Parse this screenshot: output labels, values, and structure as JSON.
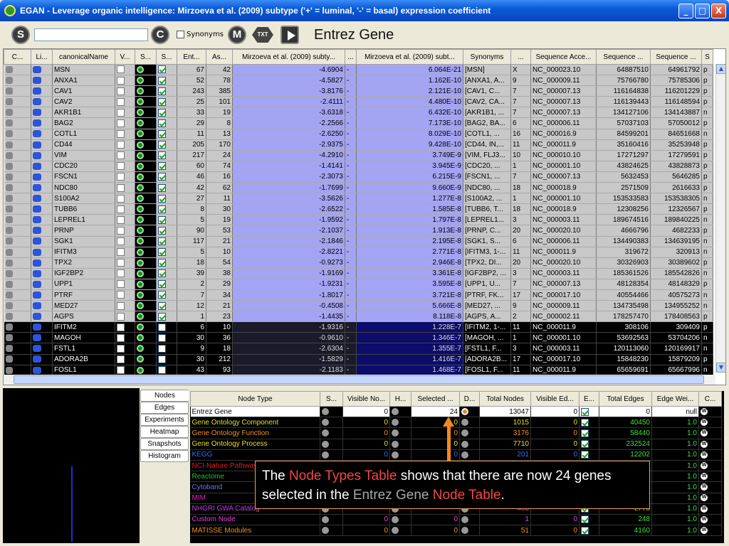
{
  "window": {
    "title": "EGAN - Leverage organic intelligence: Mirzoeva et al. (2009) subtype ('+' = luminal, '-' = basal) expression coefficient",
    "min": "_",
    "max": "□",
    "close": "X"
  },
  "toolbar": {
    "s_label": "S",
    "c_label": "C",
    "m_label": "M",
    "txt_label": "TXT",
    "synonyms_label": "Synonyms",
    "search_value": "",
    "title": "Entrez Gene"
  },
  "columns": [
    "C...",
    "Li...",
    "canonicalName",
    "V...",
    "S...",
    "S...",
    "Ent...",
    "As...",
    "Mirzoeva et al. (2009) subty...",
    "...",
    "Mirzoeva et al. (2009) subt...",
    "Synonyms",
    "...",
    "Sequence Acce...",
    "Sequence ...",
    "Sequence ...",
    "S"
  ],
  "rows": [
    [
      "MSN",
      "67",
      "42",
      "-4.6904",
      "-",
      "6.064E-21",
      "[MSN]",
      "X",
      "NC_000023.10",
      "64887510",
      "64961792",
      "p"
    ],
    [
      "ANXA1",
      "52",
      "78",
      "-4.5827",
      "-",
      "1.162E-10",
      "[ANXA1, A...",
      "9",
      "NC_000009.11",
      "75766780",
      "75785306",
      "p"
    ],
    [
      "CAV1",
      "243",
      "385",
      "-3.8176",
      "-",
      "2.121E-10",
      "[CAV1, C...",
      "7",
      "NC_000007.13",
      "116164838",
      "116201229",
      "p"
    ],
    [
      "CAV2",
      "25",
      "101",
      "-2.4111",
      "-",
      "4.480E-10",
      "[CAV2, CA...",
      "7",
      "NC_000007.13",
      "116139443",
      "116148594",
      "p"
    ],
    [
      "AKR1B1",
      "33",
      "19",
      "-3.6318",
      "-",
      "6.432E-10",
      "[AKR1B1, ...",
      "7",
      "NC_000007.13",
      "134127106",
      "134143887",
      "n"
    ],
    [
      "BAG2",
      "29",
      "8",
      "-2.2566",
      "-",
      "7.173E-10",
      "[BAG2, BA...",
      "6",
      "NC_000006.11",
      "57037103",
      "57050012",
      "p"
    ],
    [
      "COTL1",
      "11",
      "13",
      "-2.6250",
      "-",
      "8.029E-10",
      "[COTL1, ...",
      "16",
      "NC_000016.9",
      "84599201",
      "84651668",
      "n"
    ],
    [
      "CD44",
      "205",
      "170",
      "-2.9375",
      "-",
      "9.428E-10",
      "[CD44, IN,...",
      "11",
      "NC_000011.9",
      "35160416",
      "35253948",
      "p"
    ],
    [
      "VIM",
      "217",
      "24",
      "-4.2910",
      "-",
      "3.749E-9",
      "[VIM, FLJ3...",
      "10",
      "NC_000010.10",
      "17271297",
      "17279591",
      "p"
    ],
    [
      "CDC20",
      "60",
      "74",
      "-1.4141",
      "-",
      "3.945E-9",
      "[CDC20, ...",
      "1",
      "NC_000001.10",
      "43824625",
      "43828873",
      "p"
    ],
    [
      "FSCN1",
      "46",
      "16",
      "-2.3073",
      "-",
      "6.215E-9",
      "[FSCN1, ...",
      "7",
      "NC_000007.13",
      "5632453",
      "5646285",
      "p"
    ],
    [
      "NDC80",
      "42",
      "62",
      "-1.7699",
      "-",
      "9.660E-9",
      "[NDC80, ...",
      "18",
      "NC_000018.9",
      "2571509",
      "2616633",
      "p"
    ],
    [
      "S100A2",
      "27",
      "11",
      "-3.5626",
      "-",
      "1.277E-8",
      "[S100A2, ...",
      "1",
      "NC_000001.10",
      "153533583",
      "153538305",
      "n"
    ],
    [
      "TUBB6",
      "8",
      "30",
      "-2.6522",
      "-",
      "1.585E-8",
      "[TUBB6, T...",
      "18",
      "NC_000018.9",
      "12308256",
      "12326567",
      "p"
    ],
    [
      "LEPREL1",
      "5",
      "19",
      "-1.9592",
      "-",
      "1.797E-8",
      "[LEPREL1...",
      "3",
      "NC_000003.11",
      "189674516",
      "189840225",
      "n"
    ],
    [
      "PRNP",
      "90",
      "53",
      "-2.1037",
      "-",
      "1.913E-8",
      "[PRNP, C...",
      "20",
      "NC_000020.10",
      "4666796",
      "4682233",
      "p"
    ],
    [
      "SGK1",
      "117",
      "21",
      "-2.1846",
      "-",
      "2.195E-8",
      "[SGK1, S...",
      "6",
      "NC_000006.11",
      "134490383",
      "134639195",
      "n"
    ],
    [
      "IFITM3",
      "5",
      "10",
      "-2.8221",
      "-",
      "2.771E-8",
      "[IFITM3, 1-...",
      "11",
      "NC_000011.9",
      "319672",
      "320913",
      "n"
    ],
    [
      "TPX2",
      "18",
      "54",
      "-0.9273",
      "-",
      "2.946E-8",
      "[TPX2, DI...",
      "20",
      "NC_000020.10",
      "30326903",
      "30389602",
      "p"
    ],
    [
      "IGF2BP2",
      "39",
      "38",
      "-1.9169",
      "-",
      "3.361E-8",
      "[IGF2BP2, ...",
      "3",
      "NC_000003.11",
      "185361526",
      "185542826",
      "n"
    ],
    [
      "UPP1",
      "2",
      "29",
      "-1.9231",
      "-",
      "3.595E-8",
      "[UPP1, U...",
      "7",
      "NC_000007.13",
      "48128354",
      "48148329",
      "p"
    ],
    [
      "PTRF",
      "7",
      "34",
      "-1.8017",
      "-",
      "3.721E-8",
      "[PTRF, FK...",
      "17",
      "NC_000017.10",
      "40554466",
      "40575273",
      "n"
    ],
    [
      "MED27",
      "12",
      "21",
      "-0.4508",
      "-",
      "5.666E-8",
      "[MED27, ...",
      "9",
      "NC_000009.11",
      "134735498",
      "134955252",
      "n"
    ],
    [
      "AGPS",
      "1",
      "23",
      "-1.4435",
      "-",
      "8.118E-8",
      "[AGPS, A...",
      "2",
      "NC_000002.11",
      "178257470",
      "178408563",
      "p"
    ],
    [
      "IFITM2",
      "6",
      "10",
      "-1.9316",
      "-",
      "1.228E-7",
      "[IFITM2, 1-...",
      "11",
      "NC_000011.9",
      "308106",
      "309409",
      "p"
    ],
    [
      "MAGOH",
      "30",
      "36",
      "-0.9610",
      "-",
      "1.346E-7",
      "[MAGOH, ...",
      "1",
      "NC_000001.10",
      "53692563",
      "53704206",
      "n"
    ],
    [
      "FSTL1",
      "9",
      "18",
      "-2.6304",
      "-",
      "1.355E-7",
      "[FSTL1, F...",
      "3",
      "NC_000003.11",
      "120113060",
      "120169917",
      "n"
    ],
    [
      "ADORA2B",
      "30",
      "212",
      "-1.5829",
      "-",
      "1.416E-7",
      "[ADORA2B...",
      "17",
      "NC_000017.10",
      "15848230",
      "15879209",
      "p"
    ],
    [
      "FOSL1",
      "43",
      "93",
      "-2.1183",
      "-",
      "1.468E-7",
      "[FOSL1, F...",
      "11",
      "NC_000011.9",
      "65659691",
      "65667996",
      "n"
    ]
  ],
  "selected_row_count": 24,
  "side_tabs": [
    "Nodes",
    "Edges",
    "Experiments",
    "Heatmap",
    "Snapshots",
    "Histogram"
  ],
  "node_columns": [
    "Node Type",
    "S...",
    "Visible No...",
    "H...",
    "Selected ...",
    "D...",
    "Total Nodes",
    "Visible Ed...",
    "E...",
    "Total Edges",
    "Edge Wei...",
    "C..."
  ],
  "node_rows": [
    {
      "name": "Entrez Gene",
      "color": "#000000",
      "visible": "0",
      "selected": "24",
      "total": "13047",
      "vis_edges": "0",
      "total_edges": "0",
      "weight": "null"
    },
    {
      "name": "Gene Ontology Component",
      "color": "#e0e020",
      "visible": "0",
      "selected": "0",
      "total": "1015",
      "vis_edges": "0",
      "total_edges": "40450",
      "weight": "1.0"
    },
    {
      "name": "Gene Ontology Function",
      "color": "#f09020",
      "visible": "0",
      "selected": "0",
      "total": "3176",
      "vis_edges": "0",
      "total_edges": "58440",
      "weight": "1.0"
    },
    {
      "name": "Gene Ontology Process",
      "color": "#e8e020",
      "visible": "0",
      "selected": "0",
      "total": "7710",
      "vis_edges": "0",
      "total_edges": "232524",
      "weight": "1.0"
    },
    {
      "name": "KEGG",
      "color": "#3070f0",
      "visible": "0",
      "selected": "0",
      "total": "201",
      "vis_edges": "0",
      "total_edges": "12202",
      "weight": "1.0"
    },
    {
      "name": "NCI-Nature Pathway",
      "color": "#e02020",
      "visible": "",
      "selected": "",
      "total": "",
      "vis_edges": "",
      "total_edges": "",
      "weight": "1.0"
    },
    {
      "name": "Reactome",
      "color": "#20c020",
      "visible": "",
      "selected": "",
      "total": "",
      "vis_edges": "",
      "total_edges": "",
      "weight": "1.0"
    },
    {
      "name": "Cytoband",
      "color": "#7070f0",
      "visible": "",
      "selected": "",
      "total": "",
      "vis_edges": "",
      "total_edges": "",
      "weight": "1.0"
    },
    {
      "name": "MIM",
      "color": "#e020c0",
      "visible": "",
      "selected": "",
      "total": "",
      "vis_edges": "",
      "total_edges": "",
      "weight": "1.0"
    },
    {
      "name": "NHGRI GWA Catalog",
      "color": "#c040e0",
      "visible": "",
      "selected": "",
      "total": "403",
      "vis_edges": "",
      "total_edges": "2773",
      "weight": "1.0"
    },
    {
      "name": "Custom Node",
      "color": "#e040e0",
      "visible": "0",
      "selected": "0",
      "total": "1",
      "vis_edges": "0",
      "total_edges": "248",
      "weight": "1.0"
    },
    {
      "name": "MATISSE Modules",
      "color": "#f09020",
      "visible": "0",
      "selected": "0",
      "total": "51",
      "vis_edges": "0",
      "total_edges": "4160",
      "weight": "1.0"
    }
  ],
  "annotation": {
    "p1": "The ",
    "p2": "Node Types Table",
    "p3": " shows that there are now 24 genes selected in the ",
    "p4": "Entrez Gene",
    "p5": " ",
    "p6": "Node Table",
    "p7": "."
  }
}
